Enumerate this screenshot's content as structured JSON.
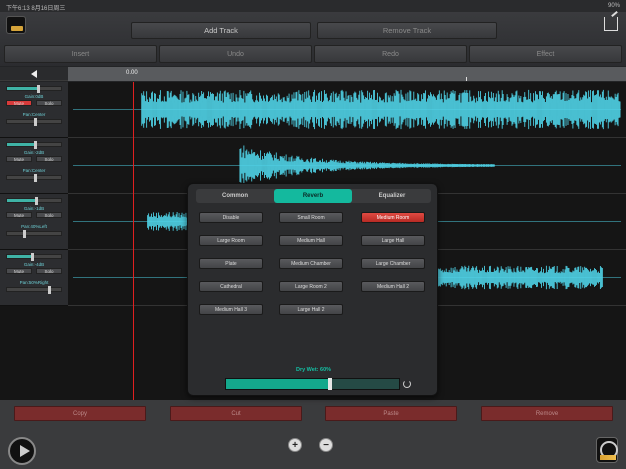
{
  "status": {
    "time": "下午6:13",
    "date": "8月16日周三",
    "battery": "90%"
  },
  "toolbar": {
    "add_track": "Add Track",
    "remove_track": "Remove Track",
    "insert": "Insert",
    "undo": "Undo",
    "redo": "Redo",
    "effect": "Effect"
  },
  "timeline": {
    "start_time": "0.00"
  },
  "tracks": [
    {
      "gain": "Gain:0dB",
      "pan": "Pan:Center",
      "mute": "Mute",
      "solo": "Solo",
      "muted": true,
      "gain_level": 0.55,
      "pan_level": 0.5
    },
    {
      "gain": "Gain:-2dB",
      "pan": "Pan:Center",
      "mute": "Mute",
      "solo": "Solo",
      "muted": false,
      "gain_level": 0.5,
      "pan_level": 0.5
    },
    {
      "gain": "Gain:-1dB",
      "pan": "Pan:40%Left",
      "mute": "Mute",
      "solo": "Solo",
      "muted": false,
      "gain_level": 0.52,
      "pan_level": 0.3
    },
    {
      "gain": "Gain:-4dB",
      "pan": "Pan:50%Right",
      "mute": "Mute",
      "solo": "Solo",
      "muted": false,
      "gain_level": 0.45,
      "pan_level": 0.75
    }
  ],
  "effect_dialog": {
    "tabs": [
      "Common",
      "Reverb",
      "Equalizer"
    ],
    "active_tab": "Reverb",
    "options": [
      [
        "Disable",
        "Small Room",
        "Medium Room"
      ],
      [
        "Large Room",
        "Medium Hall",
        "Large Hall"
      ],
      [
        "Plate",
        "Medium Chamber",
        "Large Chamber"
      ],
      [
        "Cathedral",
        "Large Room 2",
        "Medium Hall 2"
      ],
      [
        "Medium Hall 3",
        "Large Hall 2",
        ""
      ]
    ],
    "selected_option": "Medium Room",
    "dry_wet_label": "Dry Wet: 60%",
    "dry_wet_value": 0.6
  },
  "bottom": {
    "copy": "Copy",
    "cut": "Cut",
    "paste": "Paste",
    "remove": "Remove"
  },
  "colors": {
    "accent": "#14b99e",
    "wave": "#4fd2e6",
    "selected": "#d83a3a",
    "playhead": "#e02020"
  }
}
